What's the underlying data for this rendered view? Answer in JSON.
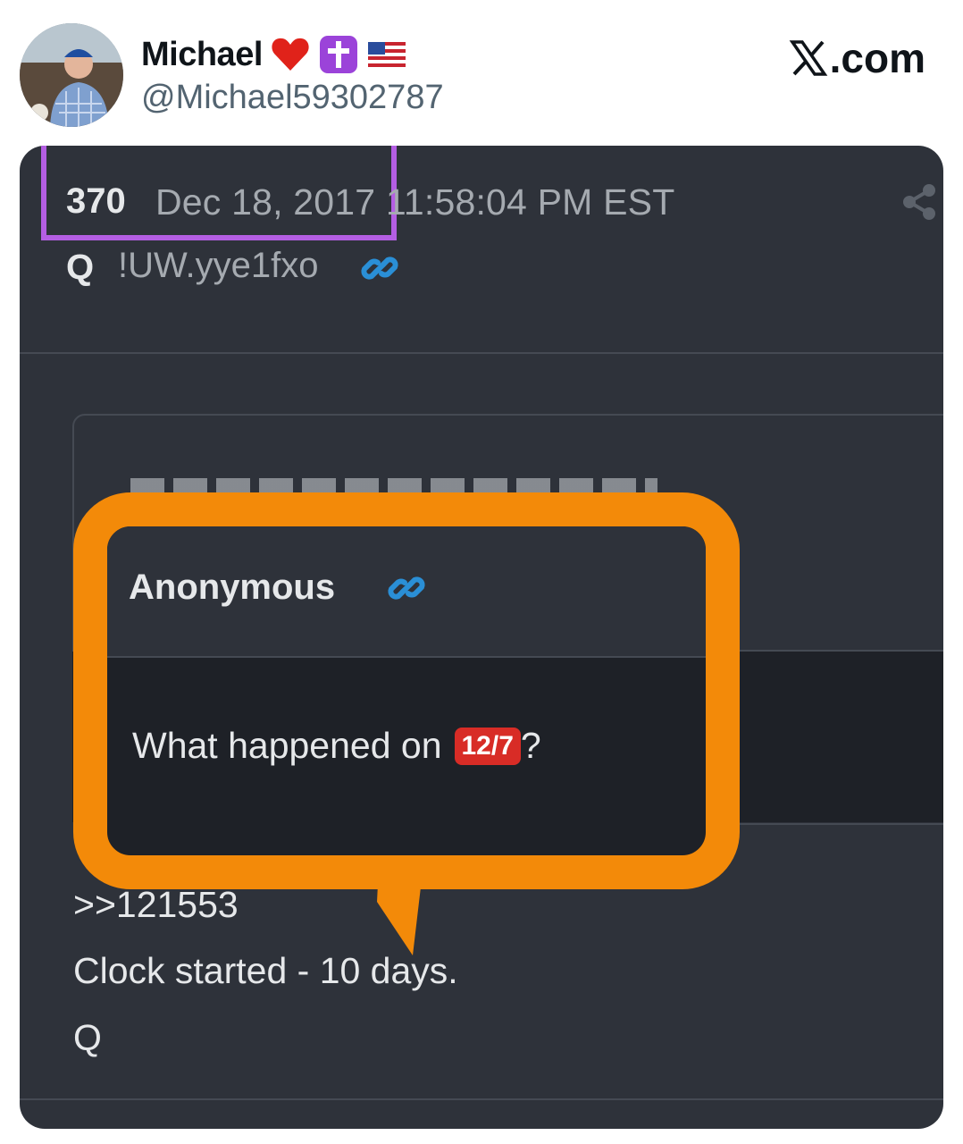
{
  "tweet": {
    "name": "Michael",
    "handle": "@Michael59302787",
    "site": ".com",
    "emojis": [
      "red-heart",
      "latin-cross",
      "us-flag"
    ]
  },
  "post": {
    "number": "370",
    "date": "Dec 18, 2017 11:58:04 PM EST",
    "author": "Q",
    "tripcode": "!UW.yye1fxo",
    "quoted": {
      "author": "Anonymous",
      "question": "What happened on",
      "badge": "12/7",
      "question_end": "?"
    },
    "body": [
      ">>121553",
      "Clock started - 10 days.",
      "Q"
    ]
  },
  "colors": {
    "card_bg": "#2e323a",
    "dark_bg": "#1e2127",
    "highlight_purple": "#b45ee3",
    "highlight_orange": "#f38a09",
    "badge_red": "#d82c26",
    "link_blue": "#2a8fd6"
  }
}
